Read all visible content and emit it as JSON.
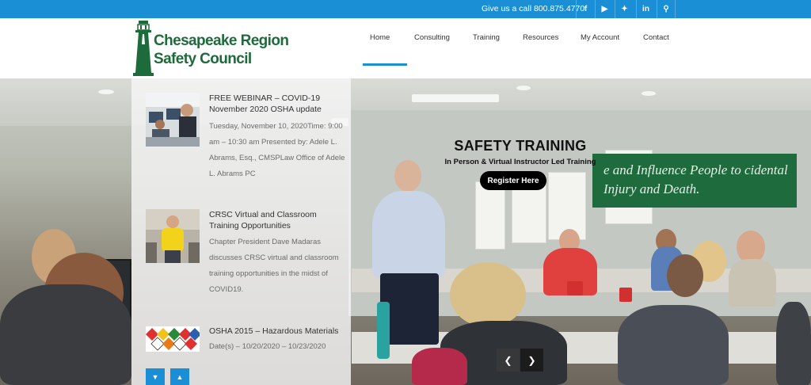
{
  "topbar": {
    "phone_text": "Give us a call 800.875.4770",
    "social": [
      {
        "icon": "facebook-icon",
        "glyph": "f"
      },
      {
        "icon": "youtube-icon",
        "glyph": "▶"
      },
      {
        "icon": "twitter-icon",
        "glyph": "✦"
      },
      {
        "icon": "linkedin-icon",
        "glyph": "in"
      },
      {
        "icon": "search-icon",
        "glyph": "⚲"
      }
    ]
  },
  "logo": {
    "line1": "Chesapeake Region",
    "line2": "Safety Council",
    "icon": "lighthouse-icon"
  },
  "nav": {
    "items": [
      "Home",
      "Consulting",
      "Training",
      "Resources",
      "My Account",
      "Contact"
    ],
    "active": "Home"
  },
  "sidebar": {
    "posts": [
      {
        "title": "FREE WEBINAR – COVID-19 November 2020 OSHA update",
        "description": "Tuesday, November 10, 2020Time: 9:00 am – 10:30 am Presented by: Adele L. Abrams, Esq., CMSPLaw Office of Adele L. Abrams PC"
      },
      {
        "title": "CRSC Virtual and Classroom Training Opportunities",
        "description": "Chapter President Dave Madaras discusses CRSC virtual and classroom training opportunities in the midst of COVID19."
      },
      {
        "title": "OSHA 2015 – Hazardous Materials",
        "description": "Date(s) – 10/20/2020 – 10/23/2020"
      }
    ],
    "scroll_down_icon": "chevron-down-icon",
    "scroll_up_icon": "chevron-up-icon"
  },
  "slide": {
    "title": "SAFETY TRAINING",
    "subtitle": "In Person & Virtual Instructor Led Training",
    "button_label": "Register Here",
    "banner_text": "e and Influence People to        cidental Injury and Death.",
    "prev_icon": "chevron-left-icon",
    "next_icon": "chevron-right-icon"
  },
  "colors": {
    "topbar": "#1a8fd6",
    "logo_green": "#1d6b3a",
    "banner_green": "#1e6b3d",
    "accent": "#1a8fd6"
  }
}
